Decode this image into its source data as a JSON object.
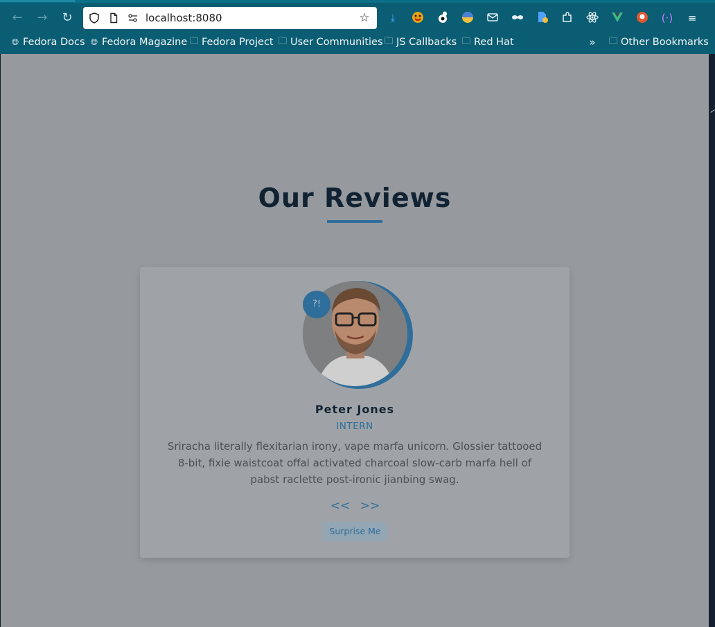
{
  "browser": {
    "url": "localhost:8080",
    "accent": "#0a5d73",
    "bookmarks": [
      {
        "label": "Fedora Docs",
        "icon": "globe-icon"
      },
      {
        "label": "Fedora Magazine",
        "icon": "globe-icon"
      },
      {
        "label": "Fedora Project",
        "icon": "folder-icon"
      },
      {
        "label": "User Communities",
        "icon": "folder-icon"
      },
      {
        "label": "JS Callbacks",
        "icon": "folder-icon"
      },
      {
        "label": "Red Hat",
        "icon": "folder-icon"
      }
    ],
    "other_bookmarks": "Other Bookmarks"
  },
  "page": {
    "title": "Our Reviews",
    "accent": "#2f6e9a",
    "review": {
      "name": "Peter Jones",
      "job": "INTERN",
      "text": "Sriracha literally flexitarian irony, vape marfa unicorn. Glossier tattooed 8-bit, fixie waistcoat offal activated charcoal slow-carb marfa hell of pabst raclette post-ironic jianbing swag.",
      "badge": "?!"
    },
    "prev_label": "<<",
    "next_label": ">>",
    "surprise_label": "Surprise Me"
  }
}
